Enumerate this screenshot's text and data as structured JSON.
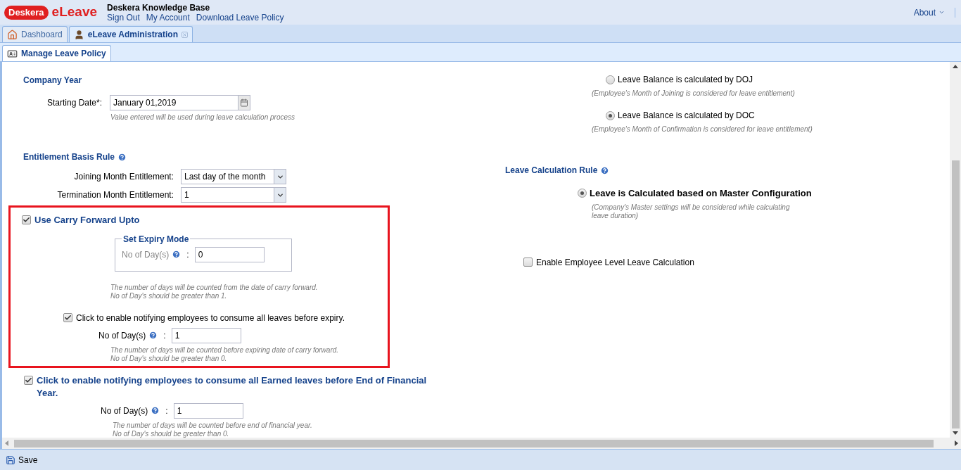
{
  "header": {
    "logo_text": "Deskera",
    "app_name": "eLeave",
    "title": "Deskera Knowledge Base",
    "links": [
      "Sign Out",
      "My Account",
      "Download Leave Policy"
    ],
    "about": "About"
  },
  "tabs": [
    {
      "label": "Dashboard",
      "selected": false,
      "closable": false
    },
    {
      "label": "eLeave Administration",
      "selected": true,
      "closable": true
    }
  ],
  "subtabs": [
    {
      "label": "Manage Leave Policy",
      "selected": true
    }
  ],
  "company_year": {
    "title": "Company Year",
    "label": "Starting Date*:",
    "value": "January 01,2019",
    "hint": "Value entered will be used during leave calculation process"
  },
  "entitlement": {
    "title": "Entitlement Basis Rule",
    "fields": [
      {
        "label": "Joining Month Entitlement:",
        "value": "Last day of the month"
      },
      {
        "label": "Termination Month Entitlement:",
        "value": "1"
      }
    ]
  },
  "carry_forward": {
    "highlighted": true,
    "checked": true,
    "label": "Use Carry Forward Upto",
    "expiry_mode": {
      "legend": "Set Expiry Mode",
      "label": "No of Day(s)",
      "separator": ":",
      "value": "0"
    },
    "hint_lines": [
      "The number of days will be counted from the date of carry forward.",
      "No of Day's should be greater than 1."
    ],
    "notify": {
      "checked": true,
      "label": "Click to enable notifying employees to consume all leaves before expiry.",
      "days_label": "No of Day(s)",
      "separator": ":",
      "value": "1",
      "hint_lines": [
        "The number of days will be counted before expiring date of carry forward.",
        "No of Day's should be greater than 0."
      ]
    }
  },
  "financial_year": {
    "checked": true,
    "label": "Click to enable notifying employees to consume all Earned leaves before End of Financial Year.",
    "days_label": "No of Day(s)",
    "separator": ":",
    "value": "1",
    "hint_lines": [
      "The number of days will be counted before end of financial year.",
      "No of Day's should be greater than 0."
    ]
  },
  "balance_options": [
    {
      "label": "Leave Balance is calculated by DOJ",
      "hint": "(Employee's Month of Joining is considered for leave entitlement)",
      "selected": false
    },
    {
      "label": "Leave Balance is calculated by DOC",
      "hint": "(Employee's Month of Confirmation is considered for leave entitlement)",
      "selected": true
    }
  ],
  "calc_rule": {
    "title": "Leave Calculation Rule",
    "options": [
      {
        "label": "Leave is Calculated based on Master Configuration",
        "hint": "(Company's Master settings will be considered while calculating leave duration)",
        "selected": true
      }
    ]
  },
  "employee_level": {
    "checked": false,
    "label": "Enable Employee Level Leave Calculation"
  },
  "toolbar": {
    "save": "Save"
  }
}
